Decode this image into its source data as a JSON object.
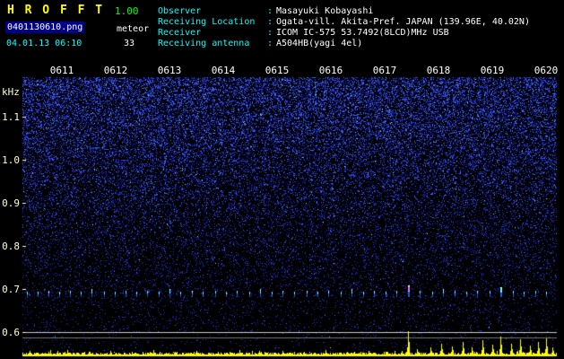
{
  "header": {
    "title": "H R O F F T",
    "version": "1.00",
    "filename": "0401130610.png",
    "mode": "meteor",
    "datetime": "04.01.13 06:10",
    "count": "33"
  },
  "info": {
    "separator": ":",
    "rows": [
      {
        "label": "Observer",
        "value": "Masayuki Kobayashi"
      },
      {
        "label": "Receiving Location",
        "value": "Ogata-vill. Akita-Pref. JAPAN (139.96E, 40.02N)"
      },
      {
        "label": "Receiver",
        "value": "ICOM IC-575 53.7492(8LCD)MHz USB"
      },
      {
        "label": "Receiving antenna",
        "value": "A504HB(yagi 4el)"
      }
    ]
  },
  "chart_data": {
    "type": "heatmap",
    "title": "HROFFT radio meteor echo spectrogram 06:10-06:20",
    "x_axis": {
      "tick_labels": [
        "0611",
        "0612",
        "0613",
        "0614",
        "0615",
        "0616",
        "0617",
        "0618",
        "0619",
        "0620"
      ],
      "unit": "hhmm",
      "minutes_range": [
        0,
        10.3
      ]
    },
    "y_axis": {
      "label": "kHz",
      "tick_labels": [
        "1.1",
        "1.0",
        "0.9",
        "0.8",
        "0.7",
        "0.6"
      ],
      "range_khz": [
        0.55,
        1.2
      ]
    },
    "echo_band_khz": 0.7,
    "colors": {
      "noise_dim": "#000077",
      "noise": "#2233cc",
      "noise_bright": "#4466ff",
      "sparkle": "#99ddff",
      "echo": "#66ffff",
      "echo_strong": "#ff55ff",
      "strength": "#ffff00",
      "grid_line": "#cccccc",
      "threshold_line": "#777777",
      "label_cyan": "#00ffff",
      "title_yellow": "#ffff00",
      "version_green": "#00ff00"
    },
    "echoes": [
      [
        0.35,
        0.35
      ],
      [
        0.55,
        0.3
      ],
      [
        0.75,
        0.45
      ],
      [
        0.95,
        0.3
      ],
      [
        1.15,
        0.4
      ],
      [
        1.35,
        0.3
      ],
      [
        1.55,
        0.5
      ],
      [
        1.78,
        0.3
      ],
      [
        1.98,
        0.35
      ],
      [
        2.18,
        0.45
      ],
      [
        2.38,
        0.3
      ],
      [
        2.58,
        0.4
      ],
      [
        2.8,
        0.35
      ],
      [
        3.0,
        0.5
      ],
      [
        3.2,
        0.3
      ],
      [
        3.42,
        0.4
      ],
      [
        3.62,
        0.35
      ],
      [
        3.85,
        0.45
      ],
      [
        4.05,
        0.3
      ],
      [
        4.25,
        0.4
      ],
      [
        4.48,
        0.35
      ],
      [
        4.68,
        0.5
      ],
      [
        4.9,
        0.3
      ],
      [
        5.1,
        0.4
      ],
      [
        5.32,
        0.35
      ],
      [
        5.55,
        0.45
      ],
      [
        5.75,
        0.3
      ],
      [
        5.95,
        0.4
      ],
      [
        6.18,
        0.35
      ],
      [
        6.38,
        0.5
      ],
      [
        6.6,
        0.3
      ],
      [
        6.8,
        0.4
      ],
      [
        7.02,
        0.35
      ],
      [
        7.22,
        0.45
      ],
      [
        7.43,
        1.0
      ],
      [
        7.65,
        0.4
      ],
      [
        7.88,
        0.35
      ],
      [
        8.08,
        0.5
      ],
      [
        8.3,
        0.4
      ],
      [
        8.52,
        0.35
      ],
      [
        8.72,
        0.45
      ],
      [
        8.95,
        0.4
      ],
      [
        9.15,
        0.8
      ],
      [
        9.38,
        0.4
      ],
      [
        9.58,
        0.35
      ],
      [
        9.8,
        0.45
      ],
      [
        10.0,
        0.35
      ]
    ],
    "strength_spikes": [
      [
        0.4,
        5
      ],
      [
        0.75,
        4
      ],
      [
        1.1,
        6
      ],
      [
        1.5,
        4
      ],
      [
        1.9,
        5
      ],
      [
        2.3,
        4
      ],
      [
        2.7,
        6
      ],
      [
        3.1,
        4
      ],
      [
        3.5,
        5
      ],
      [
        3.9,
        4
      ],
      [
        4.3,
        6
      ],
      [
        4.7,
        4
      ],
      [
        5.1,
        5
      ],
      [
        5.5,
        4
      ],
      [
        5.9,
        6
      ],
      [
        6.3,
        4
      ],
      [
        6.7,
        5
      ],
      [
        7.05,
        4
      ],
      [
        7.43,
        27
      ],
      [
        7.6,
        7
      ],
      [
        7.85,
        9
      ],
      [
        8.05,
        13
      ],
      [
        8.25,
        10
      ],
      [
        8.45,
        15
      ],
      [
        8.62,
        9
      ],
      [
        8.82,
        17
      ],
      [
        9.0,
        12
      ],
      [
        9.15,
        21
      ],
      [
        9.35,
        13
      ],
      [
        9.52,
        18
      ],
      [
        9.7,
        11
      ],
      [
        9.85,
        15
      ],
      [
        10.0,
        19
      ],
      [
        10.12,
        9
      ]
    ]
  }
}
